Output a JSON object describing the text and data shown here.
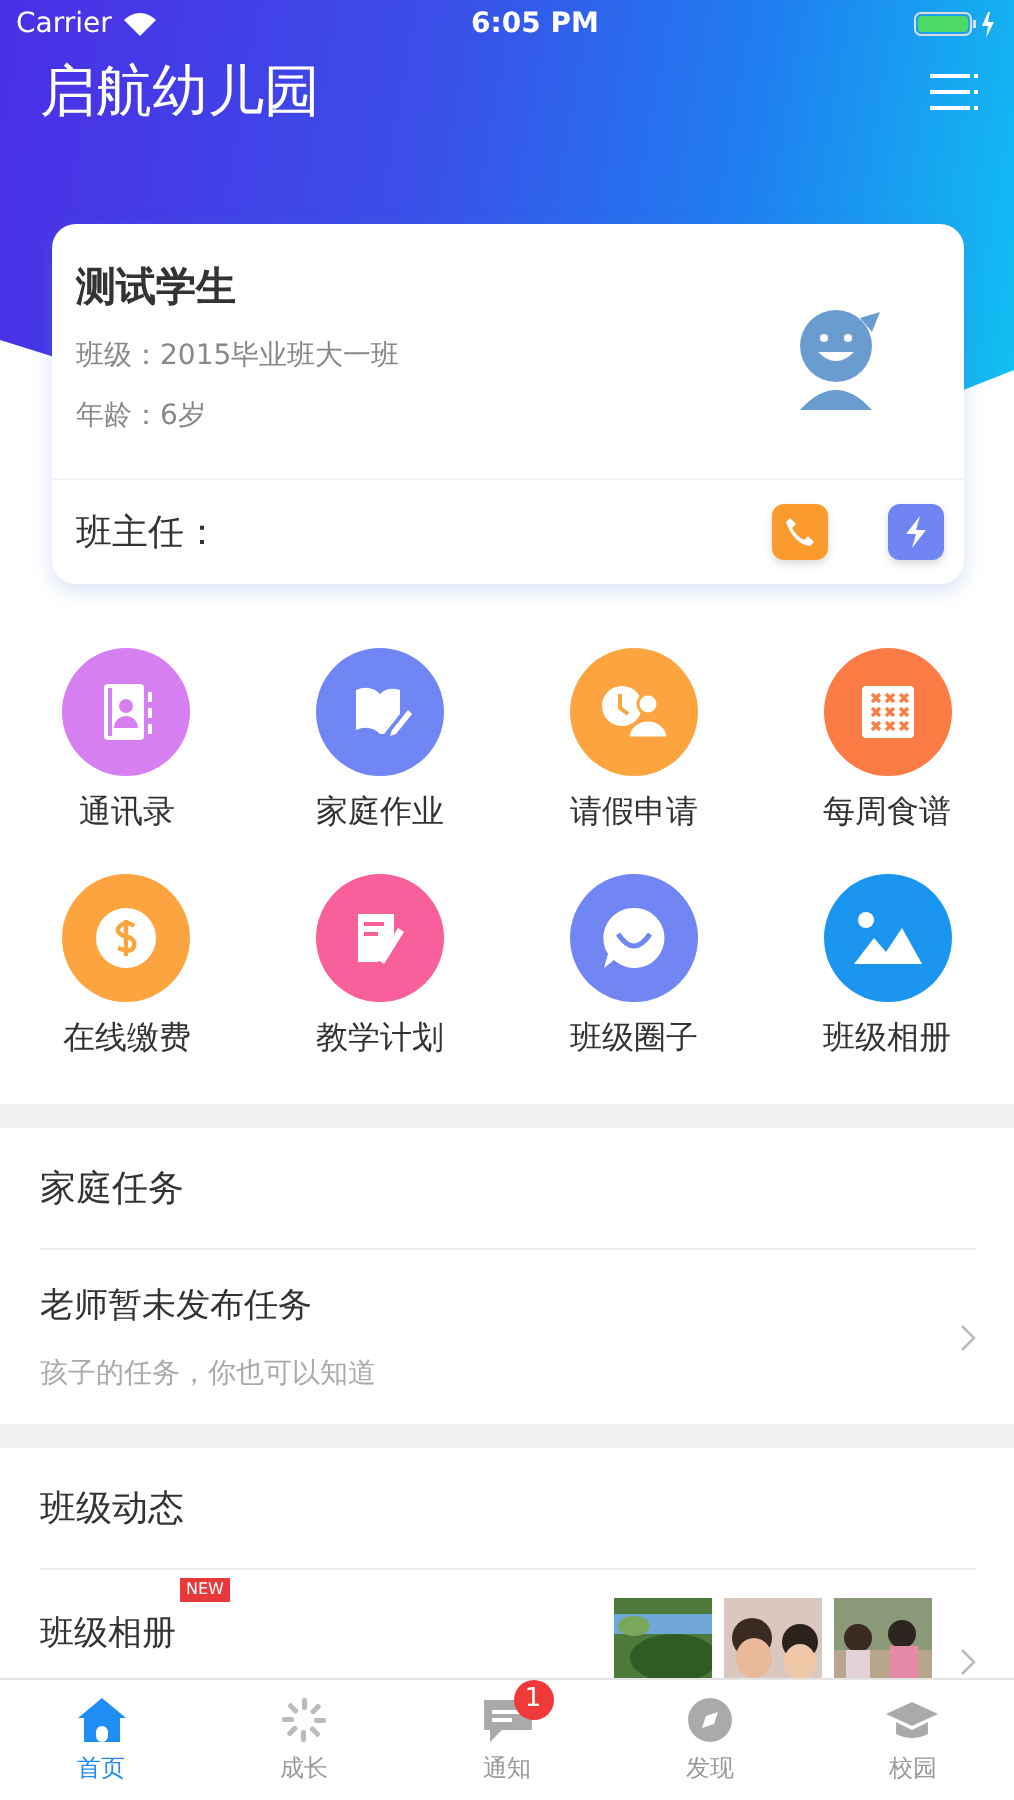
{
  "status_bar": {
    "carrier": "Carrier",
    "time": "6:05 PM"
  },
  "header": {
    "title": "启航幼儿园"
  },
  "student_card": {
    "name": "测试学生",
    "class": "班级：2015毕业班大一班",
    "age": "年龄：6岁",
    "teacher_label": "班主任："
  },
  "features": [
    {
      "label": "通讯录",
      "color": "#d57ff0"
    },
    {
      "label": "家庭作业",
      "color": "#6f86f4"
    },
    {
      "label": "请假申请",
      "color": "#fca540"
    },
    {
      "label": "每周食谱",
      "color": "#fb7c45"
    },
    {
      "label": "在线缴费",
      "color": "#fca540"
    },
    {
      "label": "教学计划",
      "color": "#f8609b"
    },
    {
      "label": "班级圈子",
      "color": "#7186f3"
    },
    {
      "label": "班级相册",
      "color": "#1a96f0"
    }
  ],
  "family_tasks": {
    "title": "家庭任务",
    "item_title": "老师暂未发布任务",
    "item_subtitle": "孩子的任务，你也可以知道"
  },
  "class_news": {
    "title": "班级动态",
    "item_title": "班级相册",
    "badge": "NEW"
  },
  "tab_bar": [
    {
      "label": "首页",
      "selected": true
    },
    {
      "label": "成长",
      "selected": false
    },
    {
      "label": "通知",
      "selected": false,
      "badge": "1"
    },
    {
      "label": "发现",
      "selected": false
    },
    {
      "label": "校园",
      "selected": false
    }
  ]
}
